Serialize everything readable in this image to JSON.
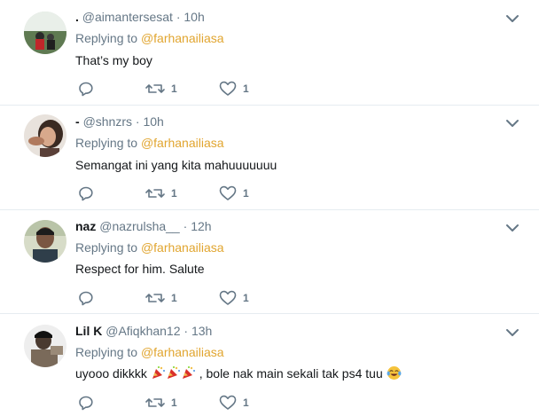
{
  "replies": [
    {
      "name": ".",
      "handle": "@aimantersesat",
      "dot": "·",
      "time": "10h",
      "replying_prefix": "Replying to",
      "replying_to": "@farhanailiasa",
      "text": "That’s my boy",
      "retweets": "1",
      "likes": "1"
    },
    {
      "name": "-",
      "handle": "@shnzrs",
      "dot": "·",
      "time": "10h",
      "replying_prefix": "Replying to",
      "replying_to": "@farhanailiasa",
      "text": "Semangat ini yang kita mahuuuuuuu",
      "retweets": "1",
      "likes": "1"
    },
    {
      "name": "naz",
      "handle": "@nazrulsha__",
      "dot": "·",
      "time": "12h",
      "replying_prefix": "Replying to",
      "replying_to": "@farhanailiasa",
      "text": "Respect for him. Salute",
      "retweets": "1",
      "likes": "1"
    },
    {
      "name": "Lil K",
      "handle": "@Afiqkhan12",
      "dot": "·",
      "time": "13h",
      "replying_prefix": "Replying to",
      "replying_to": "@farhanailiasa",
      "text_before": "uyooo dikkkk",
      "text_after": ", bole nak main sekali tak ps4 tuu",
      "retweets": "1",
      "likes": "1"
    }
  ],
  "colors": {
    "mention": "#e1a52f",
    "secondary": "#657786",
    "divider": "#e6ecf0"
  }
}
